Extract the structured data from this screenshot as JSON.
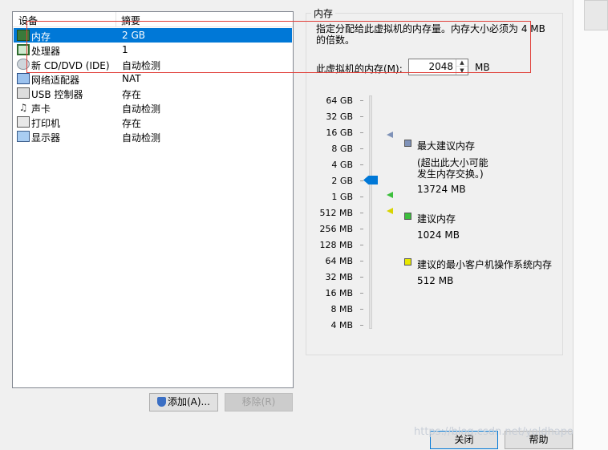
{
  "device_list": {
    "headers": {
      "device": "设备",
      "summary": "摘要"
    },
    "items": [
      {
        "name": "内存",
        "summary": "2 GB",
        "icon": "memory-icon"
      },
      {
        "name": "处理器",
        "summary": "1",
        "icon": "processor-icon"
      },
      {
        "name": "新 CD/DVD (IDE)",
        "summary": "自动检测",
        "icon": "cd-dvd-icon"
      },
      {
        "name": "网络适配器",
        "summary": "NAT",
        "icon": "network-adapter-icon"
      },
      {
        "name": "USB 控制器",
        "summary": "存在",
        "icon": "usb-icon"
      },
      {
        "name": "声卡",
        "summary": "自动检测",
        "icon": "sound-card-icon"
      },
      {
        "name": "打印机",
        "summary": "存在",
        "icon": "printer-icon"
      },
      {
        "name": "显示器",
        "summary": "自动检测",
        "icon": "display-icon"
      }
    ],
    "selected_index": 0
  },
  "buttons": {
    "add": "添加(A)...",
    "remove": "移除(R)",
    "close": "关闭",
    "help": "帮助"
  },
  "memory": {
    "group_title": "内存",
    "description": "指定分配给此虚拟机的内存量。内存大小必须为 4 MB 的倍数。",
    "field_label": "此虚拟机的内存(M):",
    "value": "2048",
    "unit": "MB",
    "scale_labels": [
      "64 GB",
      "32 GB",
      "16 GB",
      "8 GB",
      "4 GB",
      "2 GB",
      "1 GB",
      "512 MB",
      "256 MB",
      "128 MB",
      "64 MB",
      "32 MB",
      "16 MB",
      "8 MB",
      "4 MB"
    ],
    "legend": {
      "max_recommended": {
        "label": "最大建议内存",
        "note_line1": "(超出此大小可能",
        "note_line2": "发生内存交换。)",
        "value": "13724 MB",
        "color": "#7f92b8"
      },
      "recommended": {
        "label": "建议内存",
        "value": "1024 MB",
        "color": "#3cbf3c"
      },
      "guest_min": {
        "label": "建议的最小客户机操作系统内存",
        "value": "512 MB",
        "color": "#e8e800"
      }
    }
  },
  "watermark": "https://blog.csdn.net/yoldhapo",
  "colors": {
    "selection": "#0078d7",
    "annotation": "#e0403a"
  }
}
